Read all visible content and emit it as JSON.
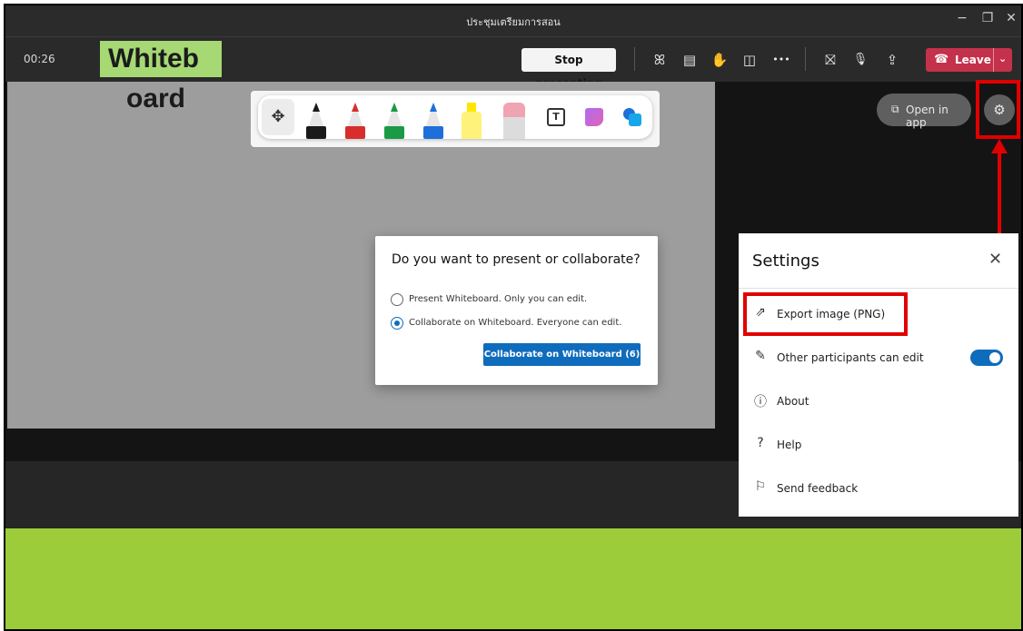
{
  "window": {
    "title": "ประชุมเตรียมการสอน",
    "minimize_icon": "−",
    "restore_icon": "❐",
    "close_icon": "✕"
  },
  "meeting_bar": {
    "timer": "00:26",
    "stop_presenting": "Stop presenting",
    "leave": "Leave",
    "icons": {
      "participants": "ꕤ",
      "chat": "▤",
      "raise_hand": "✋",
      "rooms": "◫",
      "more": "•••",
      "camera_off": "⛝",
      "mic": "🎙",
      "share": "⇪",
      "leave_phone": "☎",
      "leave_chevron": "⌄"
    }
  },
  "annotation": {
    "label_line1": "Whiteb",
    "label_line2": "oard"
  },
  "toolbar": {
    "move_icon": "✥",
    "text_tool_glyph": "T",
    "pens": [
      {
        "name": "black-pen",
        "color": "#1a1a1a"
      },
      {
        "name": "red-pen",
        "color": "#d92d2d"
      },
      {
        "name": "green-pen",
        "color": "#1a9a44"
      },
      {
        "name": "blue-pen",
        "color": "#1e6fd9"
      }
    ]
  },
  "dialog": {
    "title": "Do you want to present or collaborate?",
    "option1": "Present Whiteboard. Only you can edit.",
    "option2": "Collaborate on Whiteboard. Everyone can edit.",
    "selected_option": 2,
    "button": "Collaborate on Whiteboard (6)"
  },
  "top_right": {
    "open_in_app": "Open in app",
    "open_icon": "⧉",
    "gear_icon": "⚙"
  },
  "settings": {
    "title": "Settings",
    "close_icon": "✕",
    "items": [
      {
        "label": "Export image (PNG)",
        "icon": "⇗"
      },
      {
        "label": "Other participants can edit",
        "icon": "✎",
        "toggle": true
      },
      {
        "label": "About",
        "icon": "ⓘ"
      },
      {
        "label": "Help",
        "icon": "?"
      },
      {
        "label": "Send feedback",
        "icon": "⚐"
      }
    ]
  },
  "colors": {
    "accent": "#0f6cbd",
    "leave": "#c4314b",
    "highlight_box": "#e00000",
    "label_bg": "#a6d973",
    "bottom_band": "#9dcc3a"
  }
}
